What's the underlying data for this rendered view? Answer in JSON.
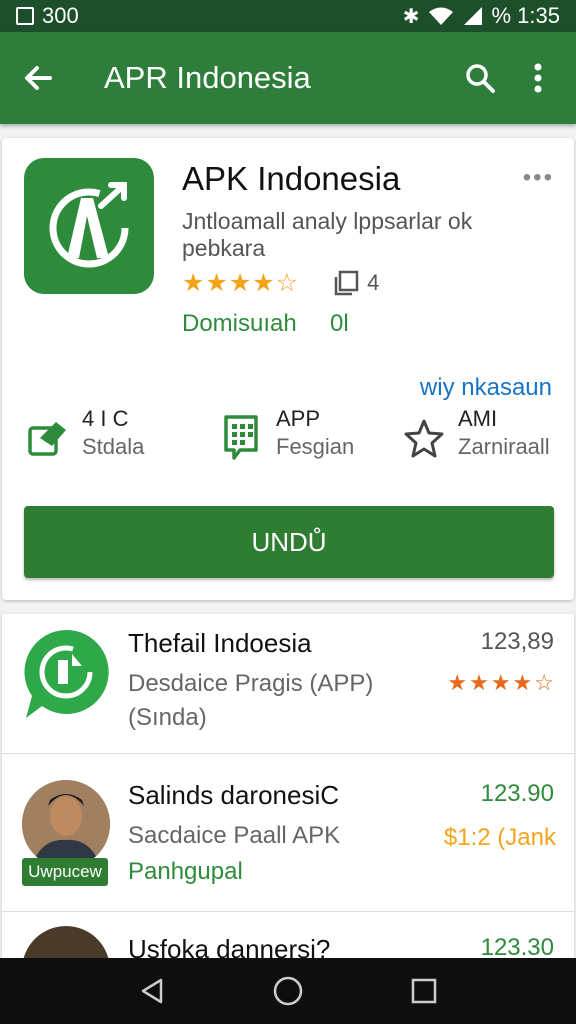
{
  "status_bar": {
    "left_text": "300",
    "right_text": "% 1:35"
  },
  "app_bar": {
    "title": "APR Indonesia"
  },
  "app": {
    "name": "APK Indonesia",
    "description": "Jntloamall analy lppsarlar ok pebkara",
    "rating_stars": 4.5,
    "stars_text": "★★★★☆",
    "count": "4",
    "developer": "Domisuıah",
    "developer_count": "0l",
    "link_text": "wiy nkasaun"
  },
  "stats": [
    {
      "top": "4 I C",
      "bottom": "Stdala",
      "icon": "export-icon"
    },
    {
      "top": "APP",
      "bottom": "Fesgian",
      "icon": "document-icon"
    },
    {
      "top": "AMI",
      "bottom": "Zarniraall",
      "icon": "star-outline-icon"
    }
  ],
  "install_button": {
    "label": "UNDŮ"
  },
  "list": [
    {
      "title": "Thefail Indoesia",
      "subtitle": "Desdaice Pragis (APP)",
      "subtitle2": "(Sında)",
      "value": "123,89",
      "rating_text": "★★★★☆",
      "value_color": "#555555"
    },
    {
      "title": "Salinds daronesiC",
      "subtitle": "Sacdaice Paall APK",
      "subtitle2": "Panhgupal",
      "value": "123.90",
      "rating_text": "$1:2 (Jank",
      "value_color": "#2e8b3c",
      "badge": "Uwpucew"
    },
    {
      "title": "Usfoka dannersi?",
      "value": "123.30",
      "value_color": "#2e8b3c"
    }
  ],
  "colors": {
    "primary": "#2e7d3a",
    "status": "#1d4f2a",
    "star": "#f2a51b",
    "link": "#1a73c8",
    "accent_green": "#2e8b3c"
  }
}
